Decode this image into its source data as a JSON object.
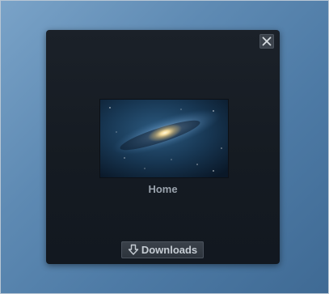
{
  "window": {
    "close_icon": "close-icon"
  },
  "desktop": {
    "label": "Home",
    "thumbnail": "galaxy-wallpaper"
  },
  "toolbar": {
    "downloads_label": "Downloads",
    "downloads_icon": "download-arrow-icon"
  },
  "colors": {
    "background": "#5e8ab3",
    "panel": "#151b22",
    "button": "#333a42",
    "label": "#9aa3ad"
  }
}
